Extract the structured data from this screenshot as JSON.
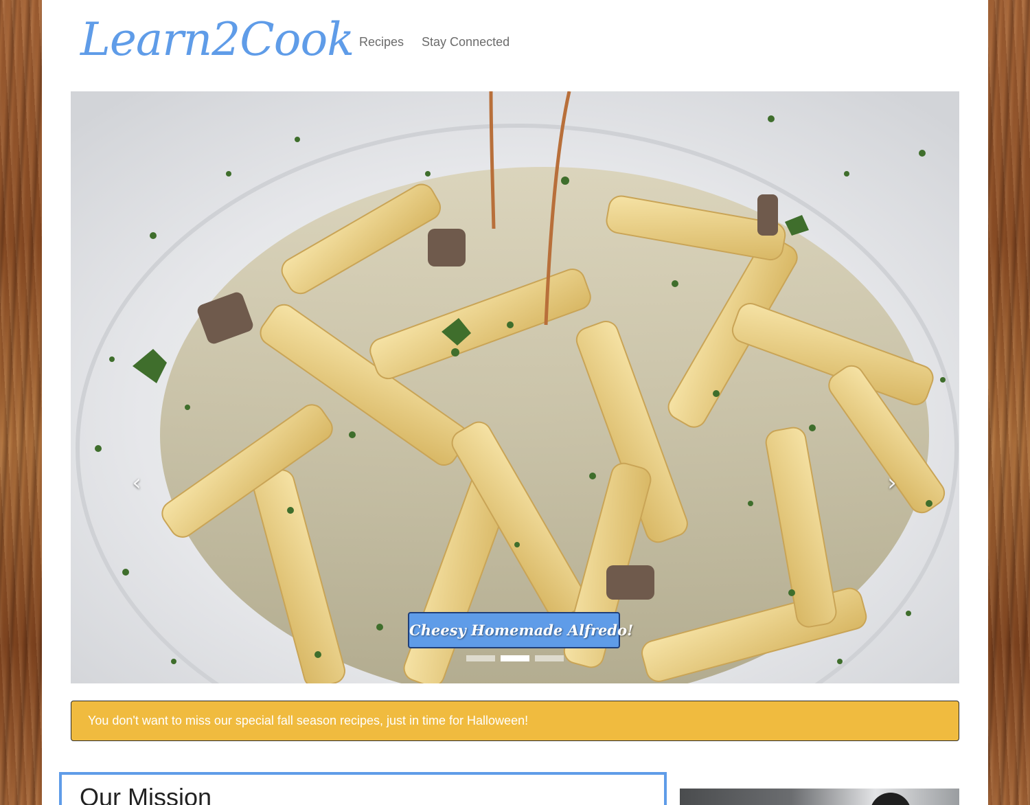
{
  "brand": {
    "logo_text": "Learn2Cook",
    "accent_color": "#5f9ce8"
  },
  "nav": {
    "items": [
      {
        "label": "Recipes"
      },
      {
        "label": "Stay Connected"
      }
    ]
  },
  "carousel": {
    "caption": "Cheesy Homemade Alfredo!",
    "prev_icon": "chevron-left-icon",
    "next_icon": "chevron-right-icon",
    "prev_glyph": "‹",
    "next_glyph": "›",
    "slide_count": 3,
    "active_index": 1
  },
  "alert": {
    "text": "You don't want to miss our special fall season recipes, just in time for Halloween!",
    "color": "#f0bb3f"
  },
  "mission": {
    "heading": "Our Mission"
  }
}
